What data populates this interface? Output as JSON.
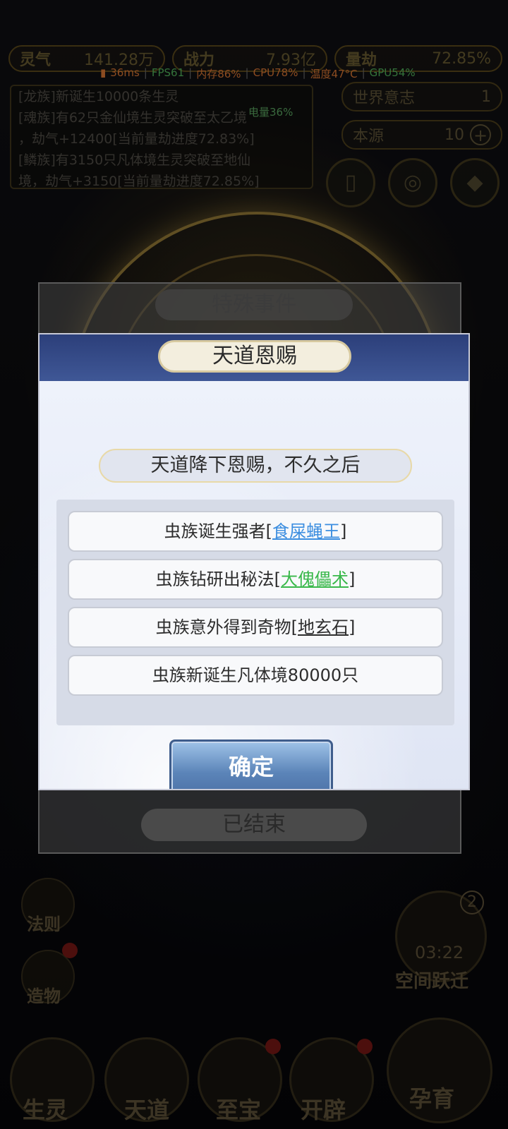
{
  "stats": {
    "spirit_label": "灵气",
    "spirit_value": "141.28万",
    "power_label": "战力",
    "power_value": "7.93亿",
    "kalpa_label": "量劫",
    "kalpa_value": "72.85%"
  },
  "perf": {
    "latency": "36ms",
    "fps": "FPS61",
    "mem": "内存86%",
    "cpu": "CPU78%",
    "temp": "温度47°C",
    "gpu": "GPU54%",
    "battery": "电量36%"
  },
  "log_lines": [
    "[龙族]新诞生10000条生灵",
    "[魂族]有62只金仙境生灵突破至太乙境",
    "，劫气+12400[当前量劫进度72.83%]",
    "[鳞族]有3150只凡体境生灵突破至地仙",
    "境，劫气+3150[当前量劫进度72.85%]"
  ],
  "side_stats": {
    "will_label": "世界意志",
    "will_value": "1",
    "origin_label": "本源",
    "origin_value": "10"
  },
  "underlying_event": {
    "title": "特殊事件",
    "status": "已结束"
  },
  "left_menu": [
    "法则",
    "造物"
  ],
  "bottom_nav": [
    "生灵",
    "天道",
    "至宝",
    "开辟",
    "孕育"
  ],
  "space_jump": {
    "badge": "2",
    "timer": "03:22",
    "label": "空间跃迁"
  },
  "dialog": {
    "title": "天道恩赐",
    "subtitle": "天道降下恩赐，不久之后",
    "items": [
      {
        "prefix": "虫族诞生强者[",
        "highlight": "食屎蝇王",
        "suffix": "]",
        "color": "#3c8ee0"
      },
      {
        "prefix": "虫族钻研出秘法[",
        "highlight": "大傀儡术",
        "suffix": "]",
        "color": "#39b84a"
      },
      {
        "prefix": "虫族意外得到奇物[",
        "highlight": "地玄石",
        "suffix": "]",
        "color": "#2d2d2d"
      },
      {
        "text": "虫族新诞生凡体境80000只"
      }
    ],
    "confirm_label": "确定"
  }
}
